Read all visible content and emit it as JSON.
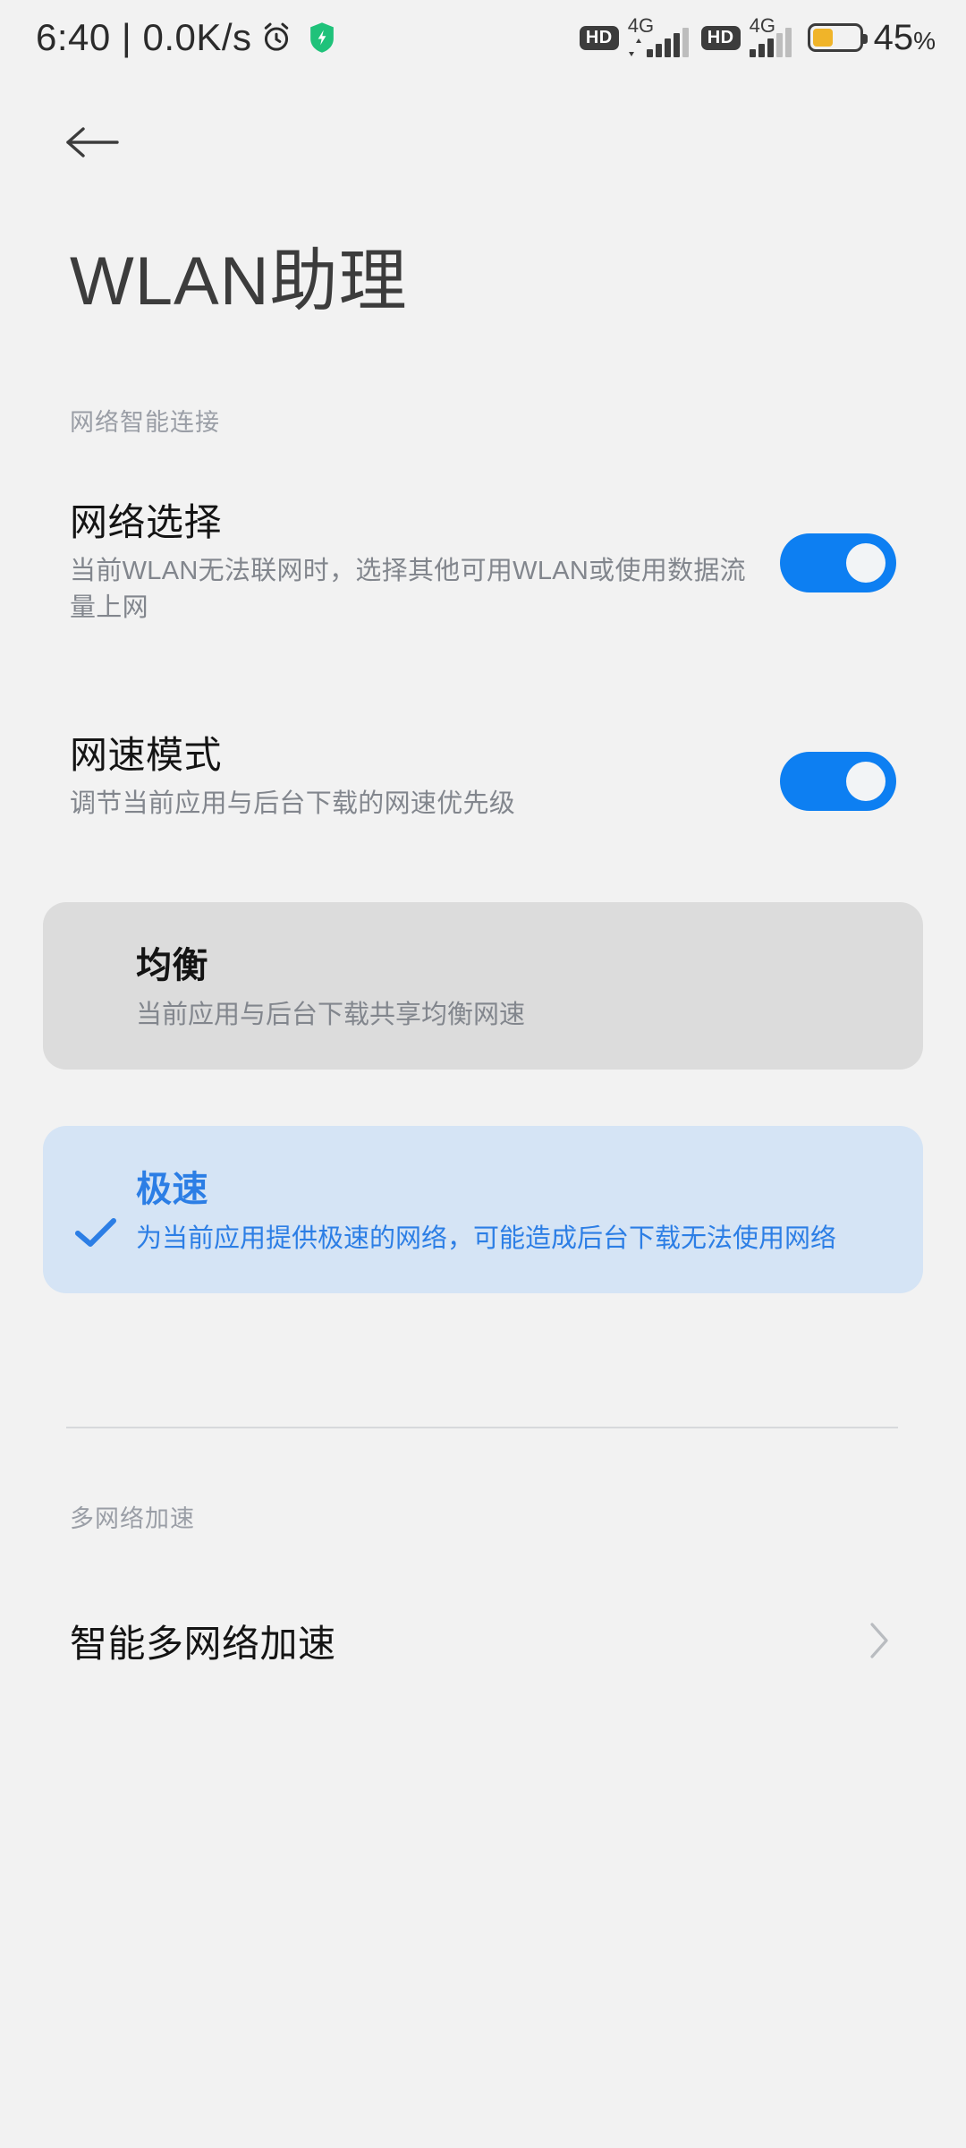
{
  "statusbar": {
    "time": "6:40",
    "separator": "|",
    "netspeed": "0.0K/s",
    "time_combined": "6:40 | 0.0K/s",
    "alarm_icon": "alarm-clock-icon",
    "shield_icon": "green-shield-icon",
    "shield_color": "#1fc27a",
    "sim1": {
      "hd": "HD",
      "network": "4G",
      "bars_active": 4,
      "bars_total": 5
    },
    "sim2": {
      "hd": "HD",
      "network": "4G",
      "bars_active": 3,
      "bars_total": 5
    },
    "battery": {
      "percent": "45",
      "percent_symbol": "%",
      "level": 45,
      "color": "#f0b429"
    }
  },
  "nav": {
    "back_icon": "back-arrow-icon"
  },
  "header": {
    "title": "WLAN助理"
  },
  "sections": [
    {
      "label": "网络智能连接",
      "settings": [
        {
          "title": "网络选择",
          "desc": "当前WLAN无法联网时，选择其他可用WLAN或使用数据流量上网",
          "toggle_on": true
        },
        {
          "title": "网速模式",
          "desc": "调节当前应用与后台下载的网速优先级",
          "toggle_on": true
        }
      ],
      "options": [
        {
          "title": "均衡",
          "desc": "当前应用与后台下载共享均衡网速",
          "selected": false
        },
        {
          "title": "极速",
          "desc": "为当前应用提供极速的网络，可能造成后台下载无法使用网络",
          "selected": true,
          "check_icon": "check-icon"
        }
      ]
    },
    {
      "label": "多网络加速",
      "rows": [
        {
          "title": "智能多网络加速",
          "chevron_icon": "chevron-right-icon"
        }
      ]
    }
  ],
  "colors": {
    "accent": "#0d7ff2",
    "selected_card_bg": "#d5e4f5",
    "selected_text": "#2c7ee5",
    "plain_card_bg": "#dcdcdc",
    "page_bg": "#f2f2f2"
  }
}
